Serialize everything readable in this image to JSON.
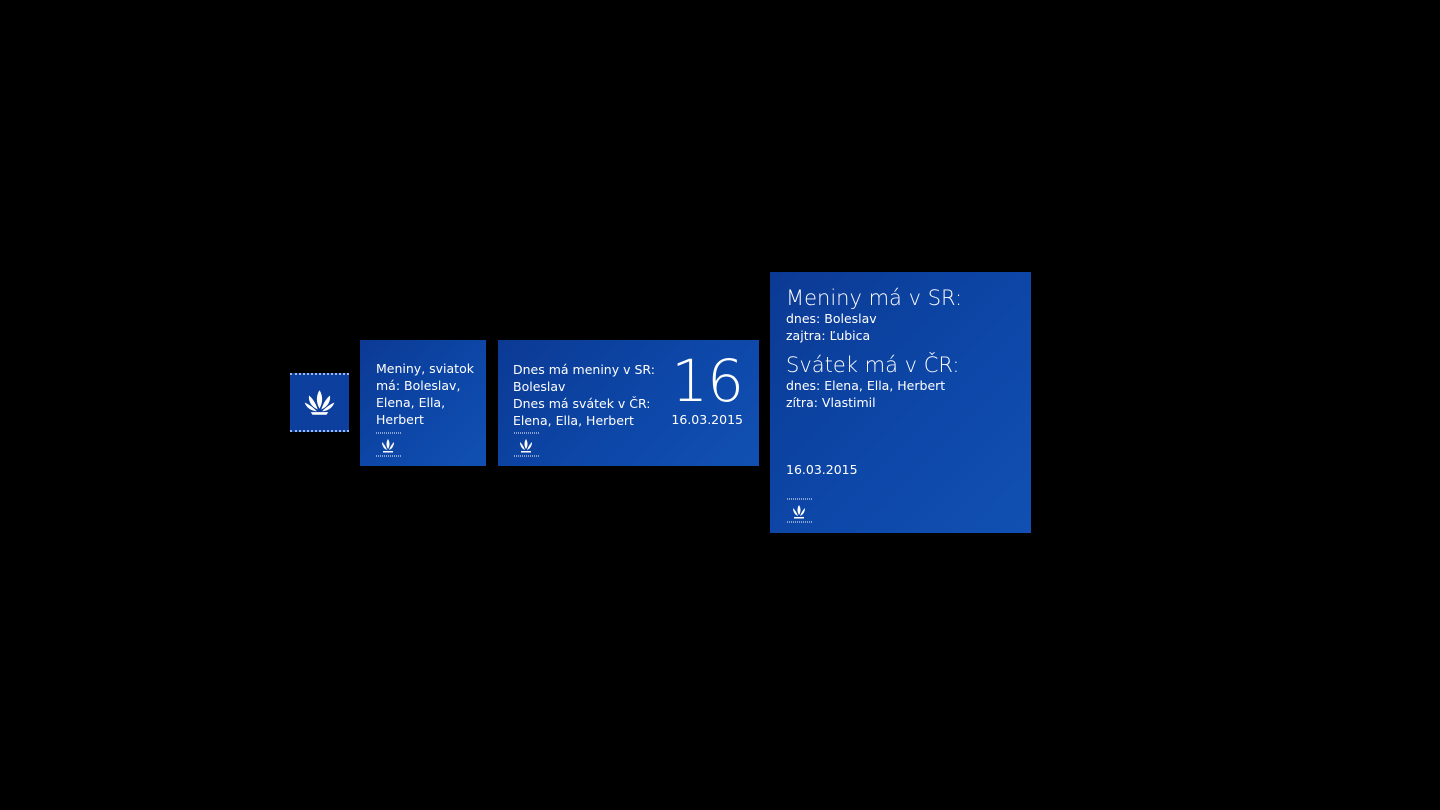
{
  "tiles": {
    "medium": {
      "text": "Meniny, sviatok má: Boleslav, Elena, Ella, Herbert"
    },
    "wide": {
      "line1": "Dnes má meniny v SR:",
      "line2": "Boleslav",
      "line3": "Dnes má svátek v ČR:",
      "line4": "Elena, Ella, Herbert",
      "day": "16",
      "date": "16.03.2015"
    },
    "large": {
      "sr_heading": "Meniny má v SR:",
      "sr_today": "dnes: Boleslav",
      "sr_tomorrow": "zajtra: Ľubica",
      "cr_heading": "Svátek má v ČR:",
      "cr_today": "dnes: Elena, Ella, Herbert",
      "cr_tomorrow": "zítra: Vlastimil",
      "date": "16.03.2015"
    }
  },
  "colors": {
    "tile_blue": "#0d47a8",
    "background": "#000000",
    "text": "#ffffff"
  },
  "icons": {
    "logo": "lotus-flower-icon"
  }
}
